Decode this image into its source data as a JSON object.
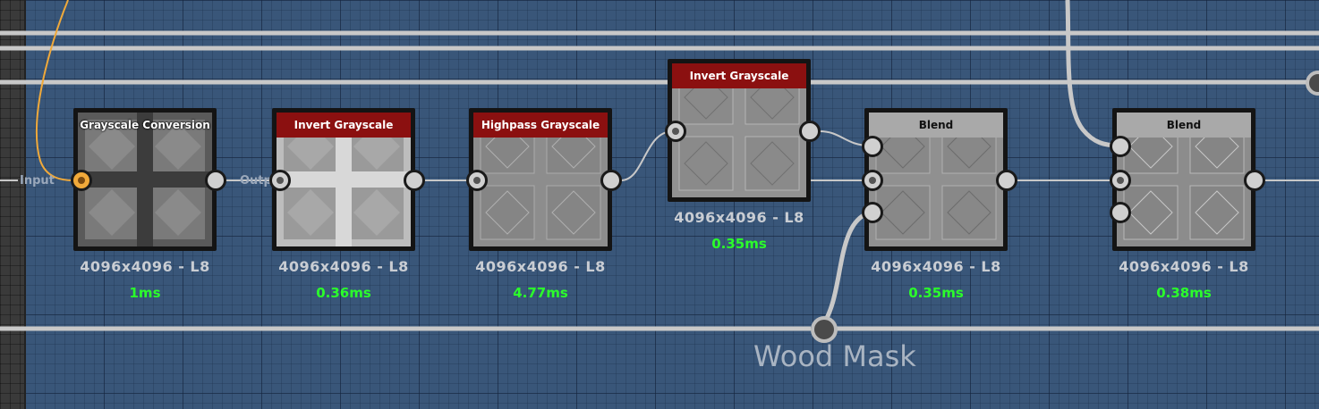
{
  "labels": {
    "input": "Input",
    "output": "Outp"
  },
  "frame_title": "Wood Mask",
  "nodes": [
    {
      "title": "Grayscale Conversion",
      "header": "clear",
      "size": "4096x4096 - L8",
      "time": "1ms"
    },
    {
      "title": "Invert Grayscale",
      "header": "red",
      "size": "4096x4096 - L8",
      "time": "0.36ms"
    },
    {
      "title": "Highpass Grayscale",
      "header": "red",
      "size": "4096x4096 - L8",
      "time": "4.77ms"
    },
    {
      "title": "Invert Grayscale",
      "header": "red",
      "size": "4096x4096 - L8",
      "time": "0.35ms"
    },
    {
      "title": "Blend",
      "header": "gray",
      "size": "4096x4096 - L8",
      "time": "0.35ms"
    },
    {
      "title": "Blend",
      "header": "gray",
      "size": "4096x4096 - L8",
      "time": "0.38ms"
    }
  ],
  "colors": {
    "canvas": "#395679",
    "red_header": "#8b1010",
    "gray_header": "#a9a9a9",
    "timing": "#2bff2b",
    "selected_wire": "#f0a93a"
  },
  "icons": {
    "port": "port-icon",
    "hub": "hub-icon"
  }
}
